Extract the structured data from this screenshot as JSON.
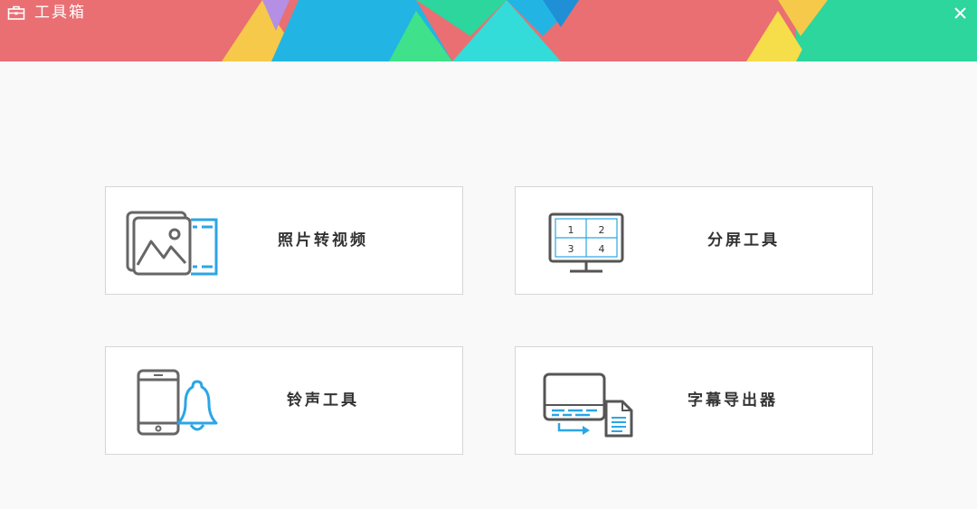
{
  "window": {
    "title": "工具箱",
    "app_icon": "toolbox-icon",
    "close_icon": "close-icon"
  },
  "tools": [
    {
      "label": "照片转视频",
      "icon": "photo-to-video-icon"
    },
    {
      "label": "分屏工具",
      "icon": "split-screen-icon",
      "icon_digits": [
        "1",
        "2",
        "3",
        "4"
      ]
    },
    {
      "label": "铃声工具",
      "icon": "ringtone-icon"
    },
    {
      "label": "字幕导出器",
      "icon": "subtitle-export-icon"
    }
  ],
  "colors": {
    "banner_red": "#e96f73",
    "banner_yellow": "#f6c94a",
    "banner_purple": "#b48fe3",
    "banner_blue": "#22b5e3",
    "banner_green": "#3fe28a",
    "banner_cyan": "#33dcd8",
    "banner_teal": "#2cd69c",
    "icon_gray": "#666666",
    "icon_blue": "#2aa6e6",
    "background": "#f9f9f9"
  }
}
